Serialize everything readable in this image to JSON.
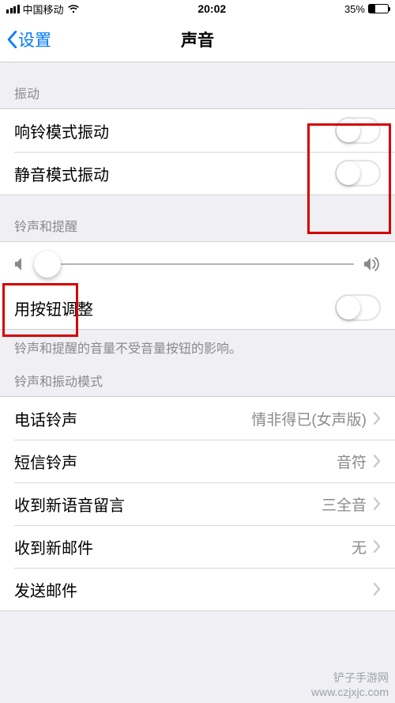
{
  "status": {
    "carrier": "中国移动",
    "time": "20:02",
    "battery_pct": "35%"
  },
  "nav": {
    "back": "设置",
    "title": "声音"
  },
  "sections": {
    "vibration": {
      "header": "振动",
      "ringer_vibrate": "响铃模式振动",
      "silent_vibrate": "静音模式振动"
    },
    "ringer_alerts": {
      "header": "铃声和提醒",
      "button_adjust": "用按钮调整",
      "footer": "铃声和提醒的音量不受音量按钮的影响。"
    },
    "patterns": {
      "header": "铃声和振动模式",
      "rows": {
        "ringtone": {
          "label": "电话铃声",
          "value": "情非得已(女声版)"
        },
        "texttone": {
          "label": "短信铃声",
          "value": "音符"
        },
        "voicemail": {
          "label": "收到新语音留言",
          "value": "三全音"
        },
        "newmail": {
          "label": "收到新邮件",
          "value": "无"
        },
        "sentmail": {
          "label": "发送邮件",
          "value": ""
        }
      }
    }
  },
  "watermark": "铲子手游网\nwww.czjxjc.com",
  "colors": {
    "accent": "#007aff",
    "highlight": "#d40000"
  }
}
